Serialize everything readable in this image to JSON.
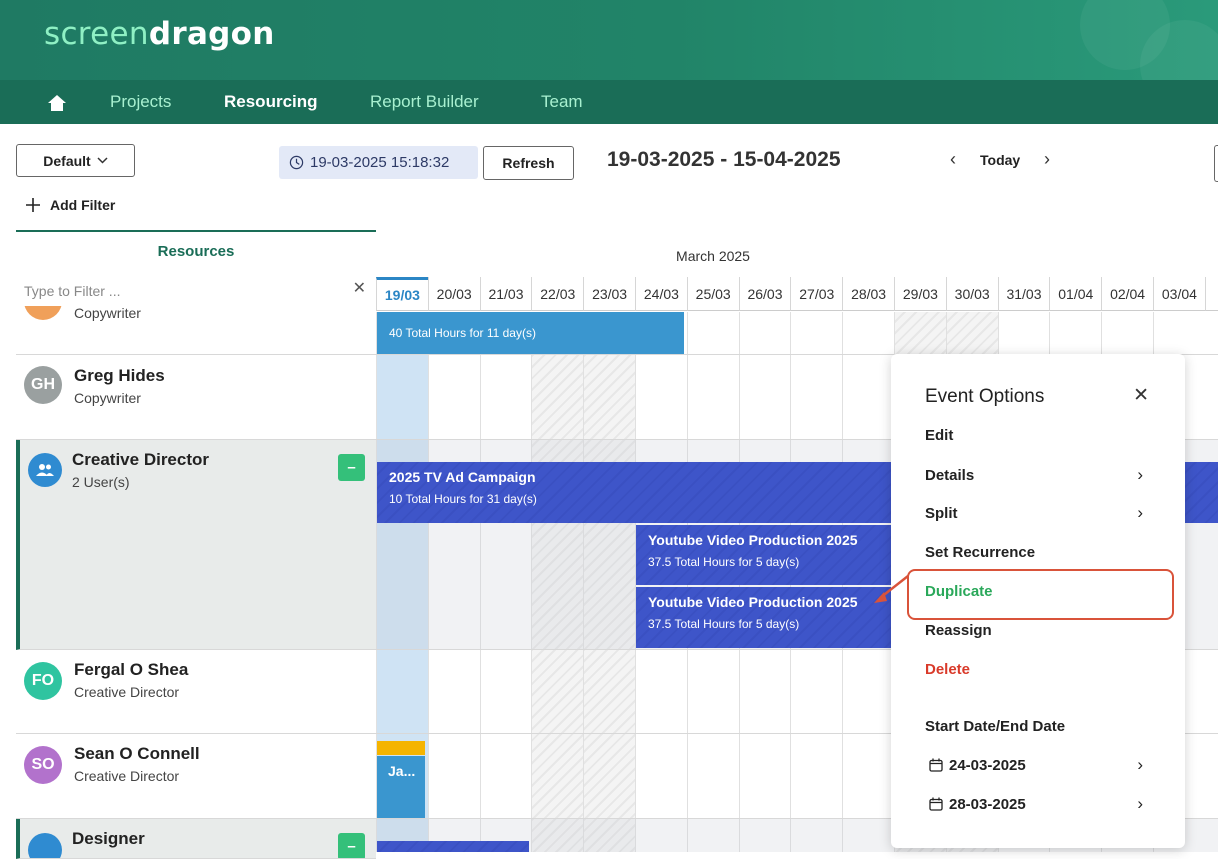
{
  "brand": {
    "part1": "screen",
    "part2": "dragon"
  },
  "nav": {
    "home_icon": "home-icon",
    "items": [
      {
        "label": "Projects",
        "active": false
      },
      {
        "label": "Resourcing",
        "active": true
      },
      {
        "label": "Report Builder",
        "active": false
      },
      {
        "label": "Team",
        "active": false
      }
    ]
  },
  "toolbar": {
    "view_select": "Default",
    "timestamp": "19-03-2025 15:18:32",
    "refresh_label": "Refresh",
    "date_range": "19-03-2025 - 15-04-2025",
    "today_label": "Today",
    "add_filter_label": "Add Filter"
  },
  "resources": {
    "title": "Resources",
    "filter_placeholder": "Type to Filter ...",
    "rows": [
      {
        "name": "",
        "role": "Copywriter",
        "initials": "",
        "color": "#f0a05a"
      },
      {
        "name": "Greg Hides",
        "role": "Copywriter",
        "initials": "GH",
        "color": "#9aa0a0"
      },
      {
        "name": "Creative Director",
        "role": "2 User(s)",
        "initials": "",
        "color": "#2f8bd1",
        "group": true
      },
      {
        "name": "Fergal O Shea",
        "role": "Creative Director",
        "initials": "FO",
        "color": "#2fc4a0"
      },
      {
        "name": "Sean O Connell",
        "role": "Creative Director",
        "initials": "SO",
        "color": "#b272cc"
      },
      {
        "name": "Designer",
        "role": "",
        "initials": "",
        "color": "#2f8bd1",
        "group": true
      }
    ]
  },
  "calendar": {
    "month_label": "March 2025",
    "days": [
      "19/03",
      "20/03",
      "21/03",
      "22/03",
      "23/03",
      "24/03",
      "25/03",
      "26/03",
      "27/03",
      "28/03",
      "29/03",
      "30/03",
      "31/03",
      "01/04",
      "02/04",
      "03/04"
    ],
    "today_index": 0,
    "weekend_indexes": [
      3,
      4,
      10,
      11
    ]
  },
  "events": [
    {
      "title": "",
      "subtitle": "40 Total Hours for 11 day(s)",
      "color": "#3a96cf"
    },
    {
      "title": "2025 TV Ad Campaign",
      "subtitle": "10 Total Hours for 31 day(s)",
      "color": "#3e55c9"
    },
    {
      "title": "Youtube Video Production 2025",
      "subtitle": "37.5 Total Hours for 5 day(s)",
      "color": "#3e55c9"
    },
    {
      "title": "Youtube Video Production 2025",
      "subtitle": "37.5 Total Hours for 5 day(s)",
      "color": "#3e55c9"
    },
    {
      "title": "Ja...",
      "subtitle": "",
      "color": "#3a96cf"
    }
  ],
  "event_options": {
    "title": "Event Options",
    "items": [
      {
        "label": "Edit",
        "has_arrow": false,
        "color": "#222222"
      },
      {
        "label": "Details",
        "has_arrow": true,
        "color": "#222222"
      },
      {
        "label": "Split",
        "has_arrow": true,
        "color": "#222222"
      },
      {
        "label": "Set Recurrence",
        "has_arrow": false,
        "color": "#222222"
      },
      {
        "label": "Duplicate",
        "has_arrow": false,
        "color": "#2aa85a"
      },
      {
        "label": "Reassign",
        "has_arrow": false,
        "color": "#222222"
      },
      {
        "label": "Delete",
        "has_arrow": false,
        "color": "#d93a2a"
      }
    ],
    "dates_label": "Start Date/End Date",
    "start_date": "24-03-2025",
    "end_date": "28-03-2025"
  }
}
